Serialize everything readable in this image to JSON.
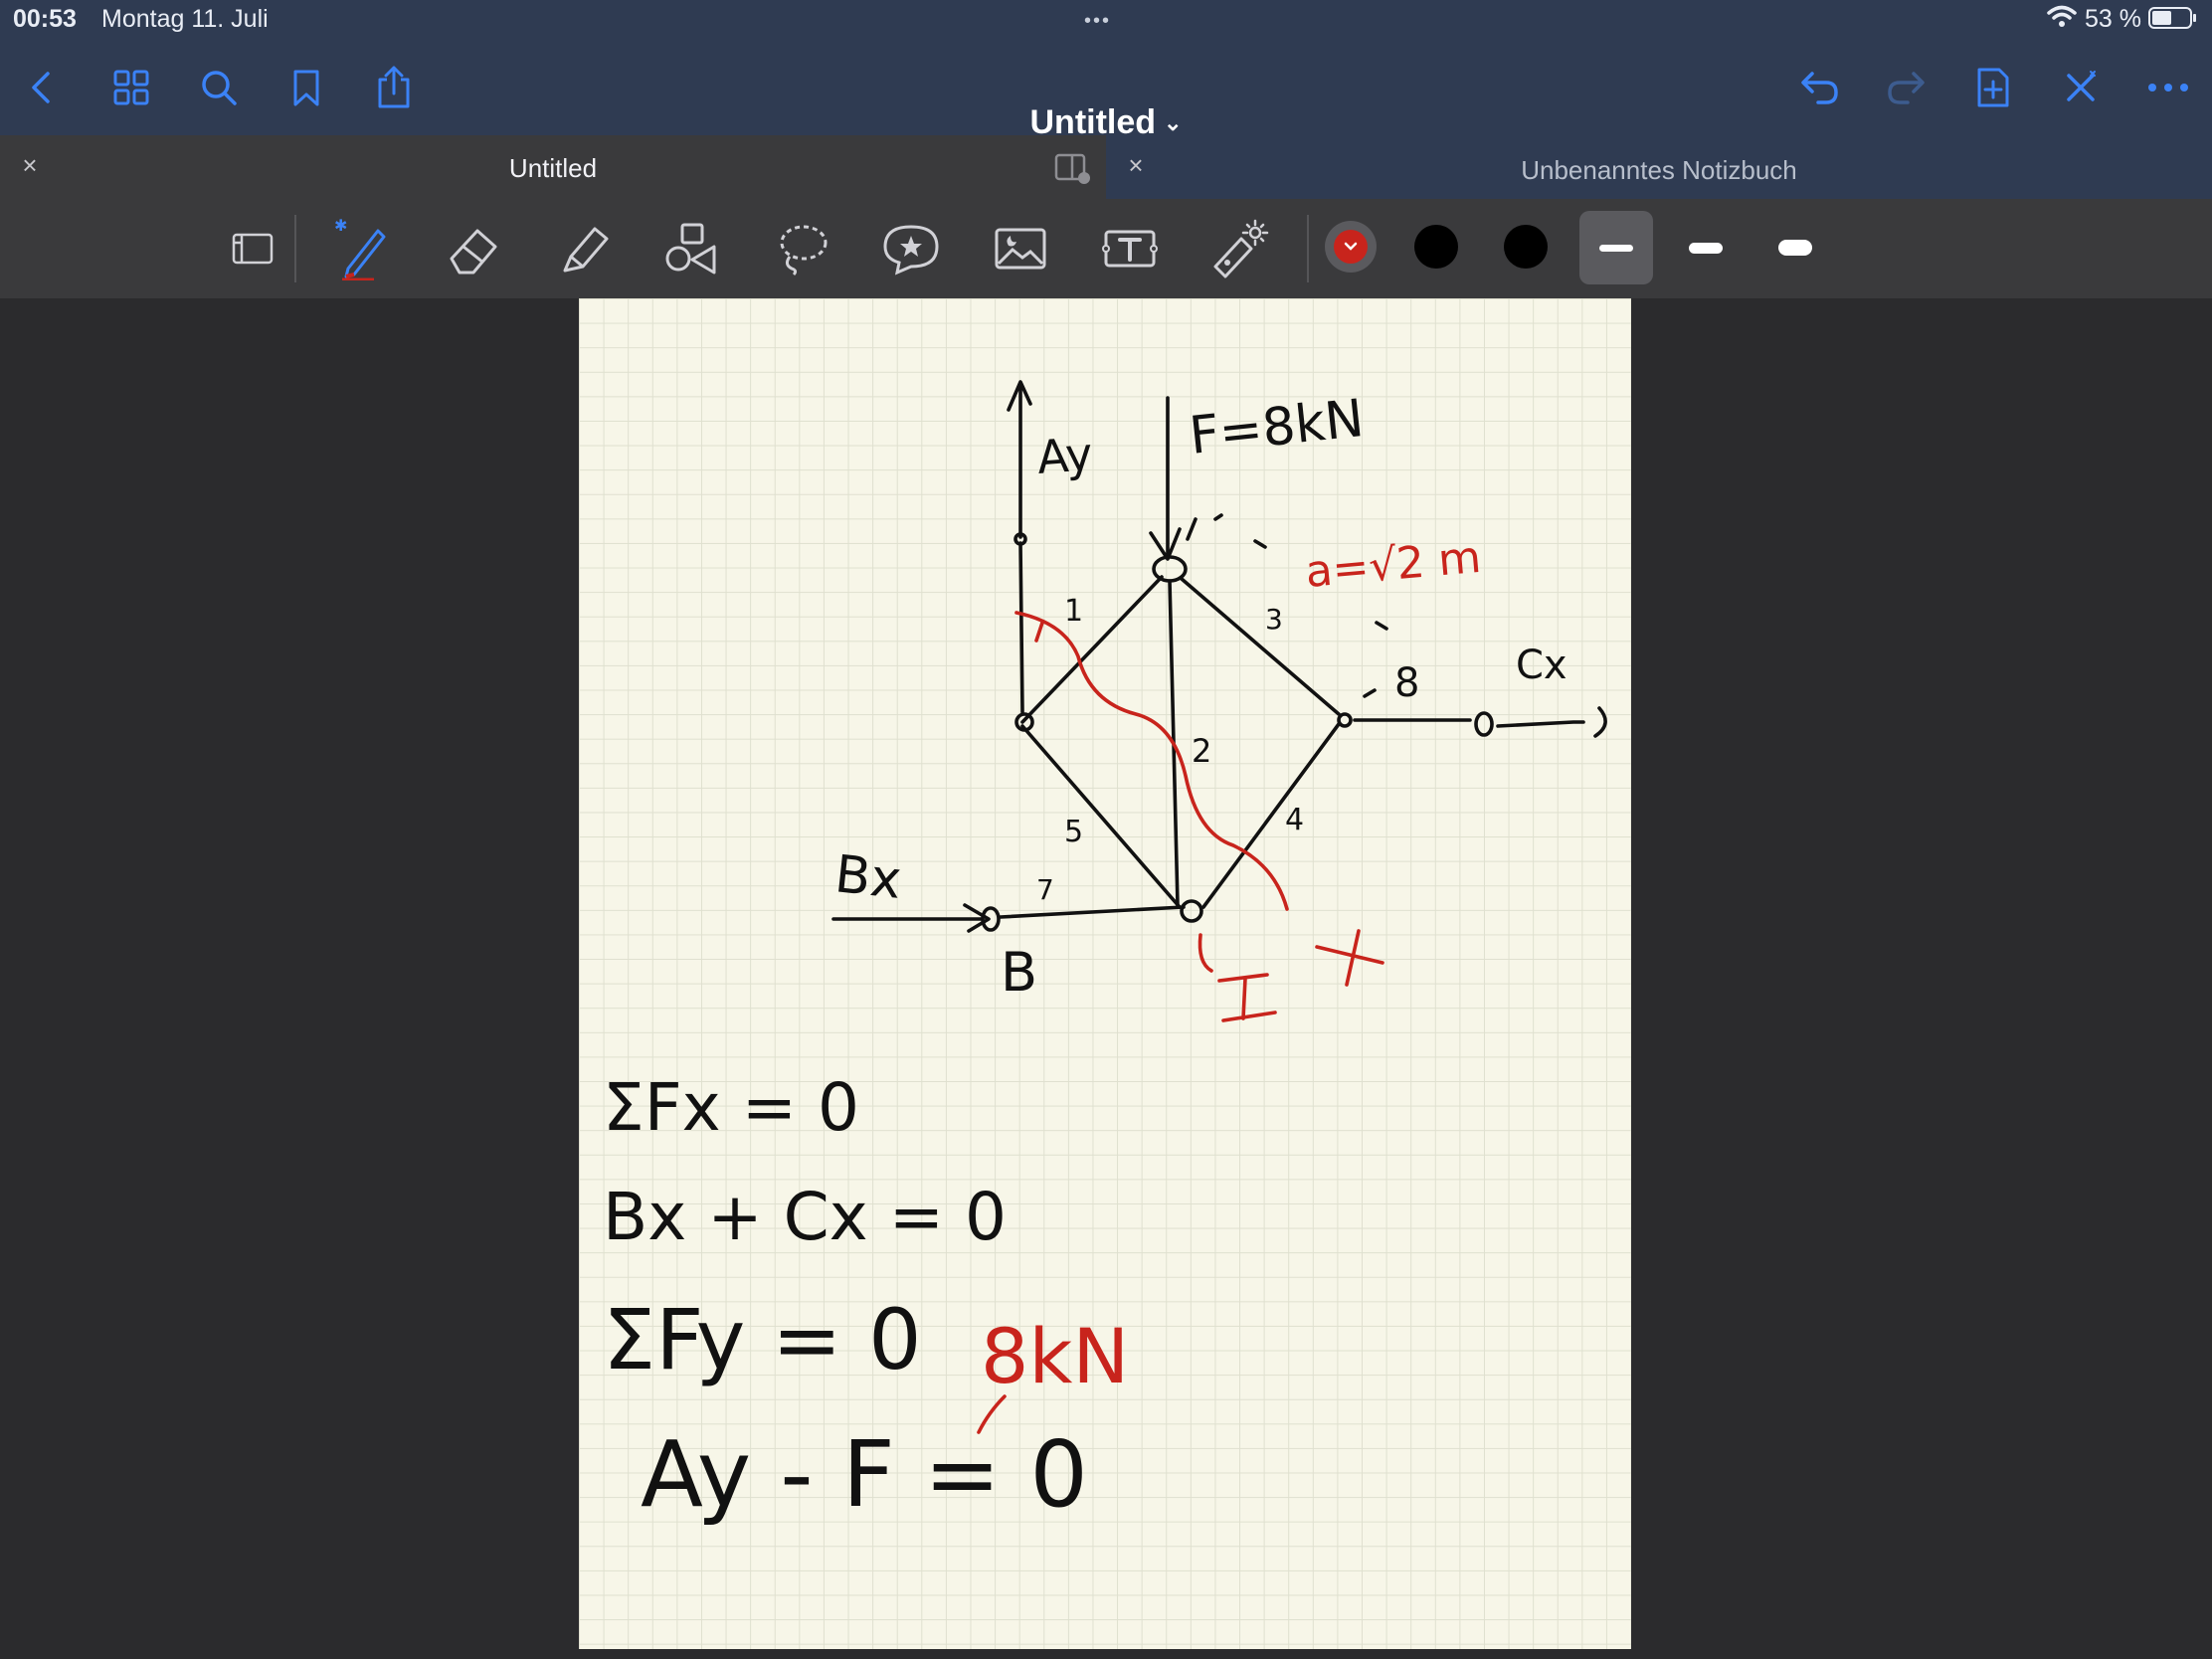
{
  "status_bar": {
    "time": "00:53",
    "date": "Montag 11. Juli",
    "multitasking_dots": "•••",
    "battery_percent": "53 %",
    "battery_level": 0.53
  },
  "nav_bar": {
    "title": "Untitled",
    "title_chevron": "⌄",
    "left_icons": [
      "back-chevron-icon",
      "grid-icon",
      "search-icon",
      "bookmark-icon",
      "share-icon"
    ],
    "right_icons": [
      "undo-icon",
      "redo-icon",
      "add-page-icon",
      "close-x-icon",
      "more-icon"
    ]
  },
  "tabs": [
    {
      "label": "Untitled",
      "close": "×"
    },
    {
      "label": "Unbenanntes Notizbuch",
      "close": "×"
    }
  ],
  "toolbar": {
    "tools": [
      "page-view-icon",
      "pen-icon",
      "eraser-icon",
      "highlighter-icon",
      "shapes-icon",
      "lasso-icon",
      "sticker-icon",
      "image-icon",
      "text-icon",
      "laser-pointer-icon"
    ],
    "colors": [
      "#c8241c",
      "#000000",
      "#000000"
    ],
    "stroke_widths": [
      "thin",
      "medium",
      "thick"
    ],
    "selected_color_index": 0,
    "selected_stroke_index": 0
  },
  "note": {
    "labels": {
      "ay": "Ay",
      "force": "F=8kN",
      "a_eq": "a=√2  m",
      "cx": "Cx",
      "bx": "Bx",
      "b": "B",
      "roman_one": "I",
      "x_mark": "x",
      "m1": "1",
      "m2": "2",
      "m3": "3",
      "m4": "4",
      "m5": "5",
      "m7": "7",
      "m8": "8"
    },
    "equations": {
      "sum_fx": "ΣFx = 0",
      "bx_cx": "Bx + Cx  = 0",
      "sum_fy": "ΣFy = 0",
      "ay_f": "Ay - F = 0",
      "eight_kn": "8kN"
    }
  }
}
